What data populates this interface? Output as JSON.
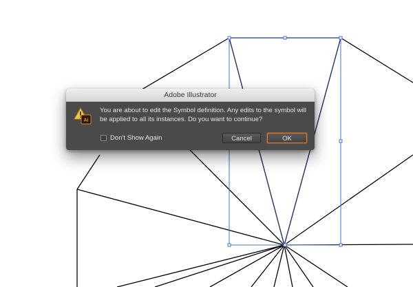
{
  "dialog": {
    "title": "Adobe Illustrator",
    "message": "You are about to edit the Symbol definition. Any edits to the symbol will be applied to all its instances. Do you want to continue?",
    "dont_show_again_label": "Don't Show Again",
    "cancel_label": "Cancel",
    "ok_label": "OK",
    "icon": "warning-triangle-icon",
    "icon_badge_text": "Ai"
  },
  "colors": {
    "dialog_background": "#4a4a4a",
    "ok_focus_ring": "#e3782a",
    "warning_yellow": "#f2c24a",
    "selection_blue": "#4a6fd6",
    "artwork_stroke": "#000000"
  }
}
